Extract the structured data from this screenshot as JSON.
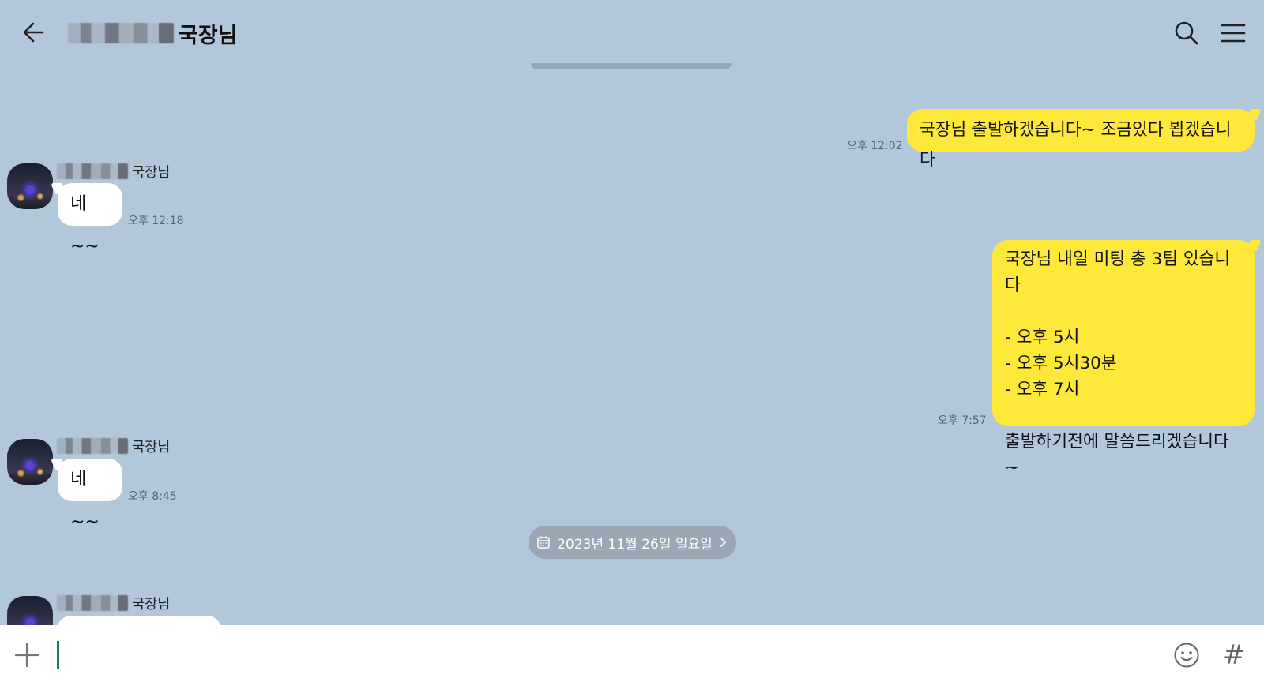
{
  "header": {
    "title": "국장님",
    "back_icon": "arrow-left-icon",
    "search_icon": "search-icon",
    "menu_icon": "hamburger-menu-icon"
  },
  "messages": [
    {
      "from": "me",
      "text": "국장님 출발하겠습니다~ 조금있다 뵙겠습니다",
      "time": "오후 12:02"
    },
    {
      "from": "other",
      "sender": "국장님",
      "text": "네~~",
      "time": "오후 12:18"
    },
    {
      "from": "me",
      "text": "국장님 내일 미팅 총 3팀 있습니다\n\n- 오후 5시\n- 오후 5시30분\n- 오후 7시\n\n출발하기전에 말씀드리겠습니다~",
      "time": "오후 7:57"
    },
    {
      "from": "other",
      "sender": "국장님",
      "text": "네~~",
      "time": "오후 8:45"
    },
    {
      "from": "other",
      "sender": "국장님",
      "text": "",
      "time": ""
    }
  ],
  "date_divider": {
    "label": "2023년 11월 26일 일요일",
    "icon": "calendar-icon"
  },
  "input_bar": {
    "value": "",
    "plus_icon": "plus-icon",
    "emoji_icon": "emoji-icon",
    "hash_icon": "hashtag-icon",
    "hash_glyph": "#"
  },
  "colors": {
    "background": "#b2c7da",
    "my_bubble": "#fee83a",
    "other_bubble": "#ffffff",
    "caret": "#137a6c"
  }
}
